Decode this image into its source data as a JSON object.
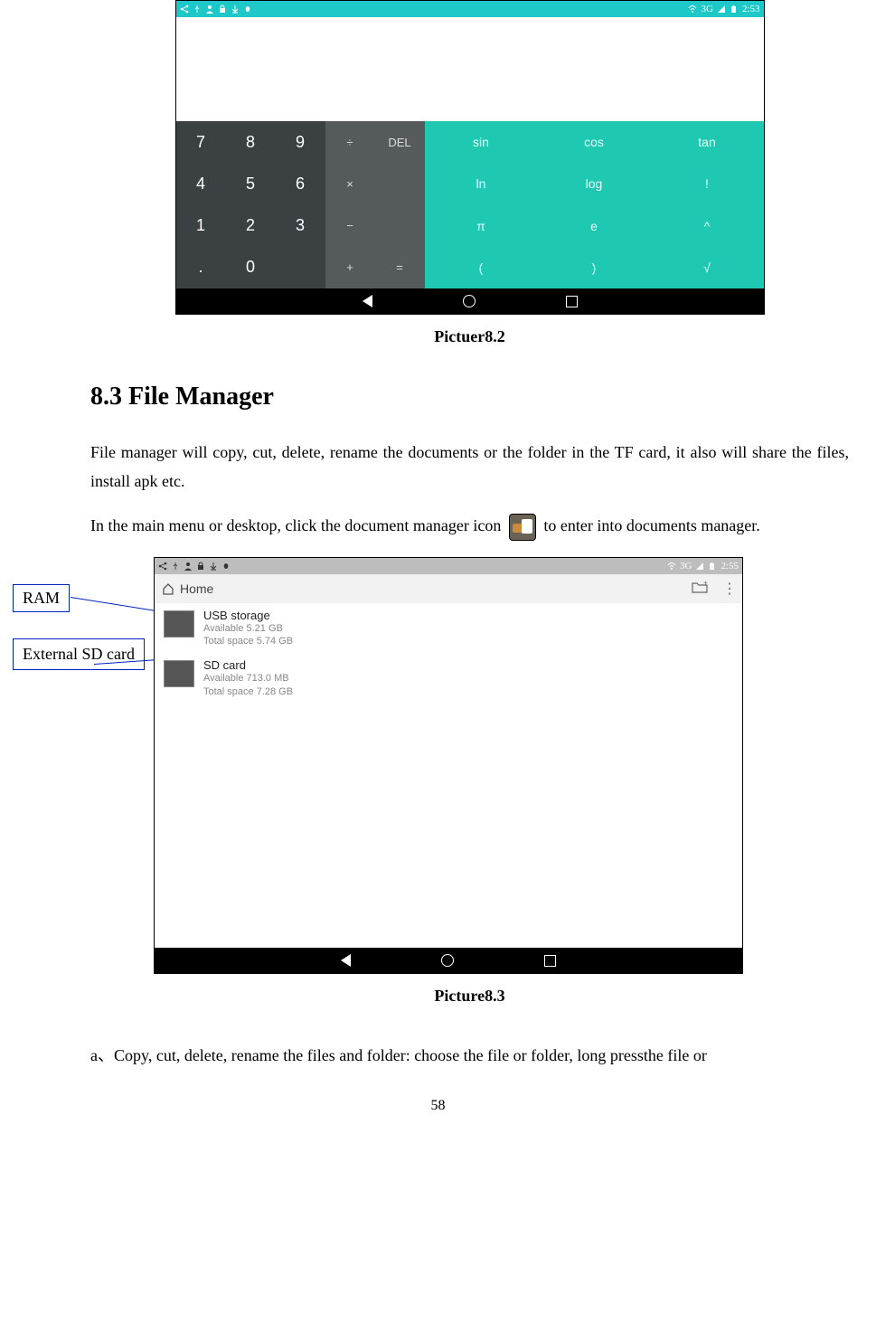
{
  "calculator": {
    "status": {
      "network_label": "3G",
      "time": "2:53"
    },
    "keys": {
      "numpad": [
        "7",
        "8",
        "9",
        "4",
        "5",
        "6",
        "1",
        "2",
        "3",
        ".",
        "0",
        ""
      ],
      "ops": [
        "÷",
        "DEL",
        "×",
        "",
        "−",
        "",
        "+",
        "="
      ],
      "sci": [
        "sin",
        "cos",
        "tan",
        "ln",
        "log",
        "!",
        "π",
        "e",
        "^",
        "(",
        ")",
        "√"
      ]
    },
    "caption": "Pictuer8.2"
  },
  "section": {
    "heading": "8.3 File Manager",
    "para1": "File manager will copy, cut, delete, rename the documents or the folder in the TF card, it also will share the files, install apk etc.",
    "para2_pre": "In the main menu or desktop, click the document manager icon ",
    "para2_post": " to enter into documents manager."
  },
  "file_manager": {
    "status": {
      "network_label": "3G",
      "time": "2:55"
    },
    "title": "Home",
    "items": [
      {
        "title": "USB storage",
        "line1": "Available 5.21 GB",
        "line2": "Total space 5.74 GB"
      },
      {
        "title": "SD card",
        "line1": "Available 713.0 MB",
        "line2": "Total space 7.28 GB"
      }
    ],
    "caption": "Picture8.3"
  },
  "callouts": {
    "ram": "RAM",
    "sd": "External SD card"
  },
  "trailing_text": "a、Copy, cut, delete, rename the files and folder: choose the file or folder, long pressthe file or",
  "page_number": "58"
}
